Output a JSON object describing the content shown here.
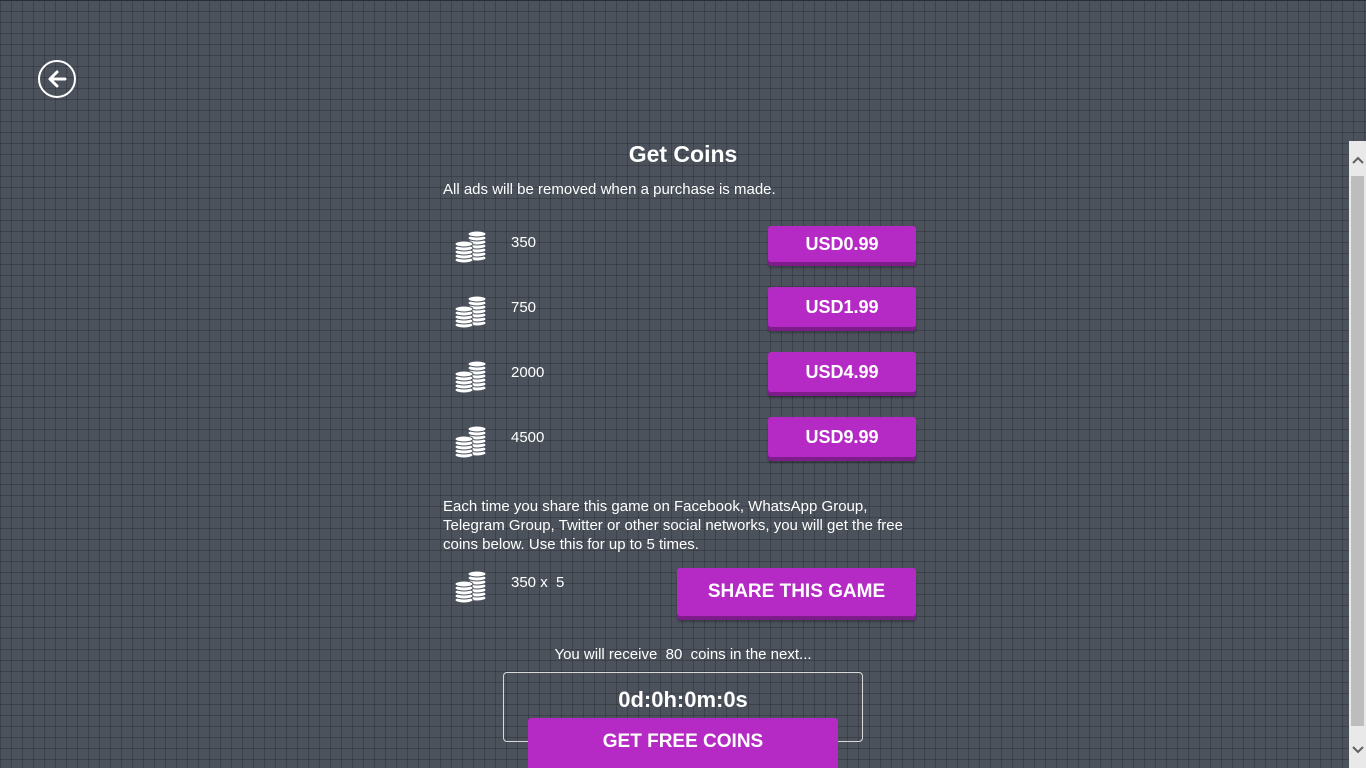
{
  "header": {
    "back_icon": "arrow-left-circle-icon"
  },
  "store": {
    "title": "Get Coins",
    "subtitle": "All ads will be removed when a purchase is made.",
    "coin_icon": "coin-stack-icon",
    "packages": [
      {
        "amount": "350",
        "price": "USD0.99"
      },
      {
        "amount": "750",
        "price": "USD1.99"
      },
      {
        "amount": "2000",
        "price": "USD4.99"
      },
      {
        "amount": "4500",
        "price": "USD9.99"
      }
    ]
  },
  "share": {
    "description": "Each time you share this game on Facebook, WhatsApp Group, Telegram Group, Twitter or other social networks, you will get the free coins below. Use this for up to 5 times.",
    "reward": "350 x  5",
    "button_label": "SHARE THIS GAME"
  },
  "free_coins": {
    "receive_text": "You will receive  80  coins in the next...",
    "timer": "0d:0h:0m:0s",
    "button_label": "GET FREE COINS"
  },
  "colors": {
    "button": "#b52ac5",
    "button_shadow": "#7e1c8c",
    "background": "#4b525c"
  }
}
